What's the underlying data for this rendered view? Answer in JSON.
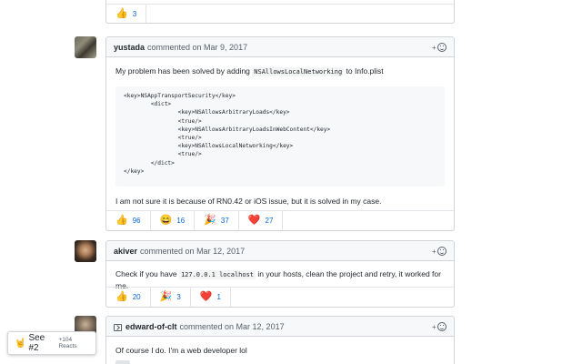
{
  "top_comment": {
    "reaction": {
      "emoji": "👍",
      "count": "3"
    }
  },
  "comments": [
    {
      "author": "yustada",
      "meta": "commented on Mar 9, 2017",
      "intro_before": "My problem has been solved by adding ",
      "intro_code": "NSAllowsLocalNetworking",
      "intro_after": " to Info.plist",
      "code_block": "<key>NSAppTransportSecurity</key>\n        <dict>\n                <key>NSAllowsArbitraryLoads</key>\n                <true/>\n                <key>NSAllowsArbitraryLoadsInWebContent</key>\n                <true/>\n                <key>NSAllowsLocalNetworking</key>\n                <true/>\n        </dict>\n</key>",
      "outro": "I am not sure it is because of RN0.42 or iOS issue, but it is solved in my case.",
      "reactions": [
        {
          "emoji": "👍",
          "count": "96"
        },
        {
          "emoji": "😄",
          "count": "16"
        },
        {
          "emoji": "🎉",
          "count": "37"
        },
        {
          "emoji": "❤️",
          "count": "27"
        }
      ]
    },
    {
      "author": "akiver",
      "meta": "commented on Mar 12, 2017",
      "text_before": "Check if you have ",
      "text_code": "127.0.0.1 localhost",
      "text_after": " in your hosts, clean the project and retry, it worked for me.",
      "reactions": [
        {
          "emoji": "👍",
          "count": "20"
        },
        {
          "emoji": "🎉",
          "count": "3"
        },
        {
          "emoji": "❤️",
          "count": "1"
        }
      ]
    },
    {
      "author": "edward-of-clt",
      "meta": "commented on Mar 12, 2017",
      "text": "Of course I do. I'm a web developer lol"
    }
  ],
  "see_plus": {
    "hand": "🤘",
    "label": "See #2",
    "sub": "+104 Reacts"
  },
  "colors": {
    "link": "#0366d6",
    "header_bg": "#f6f8fa",
    "border": "#d1d5da"
  }
}
